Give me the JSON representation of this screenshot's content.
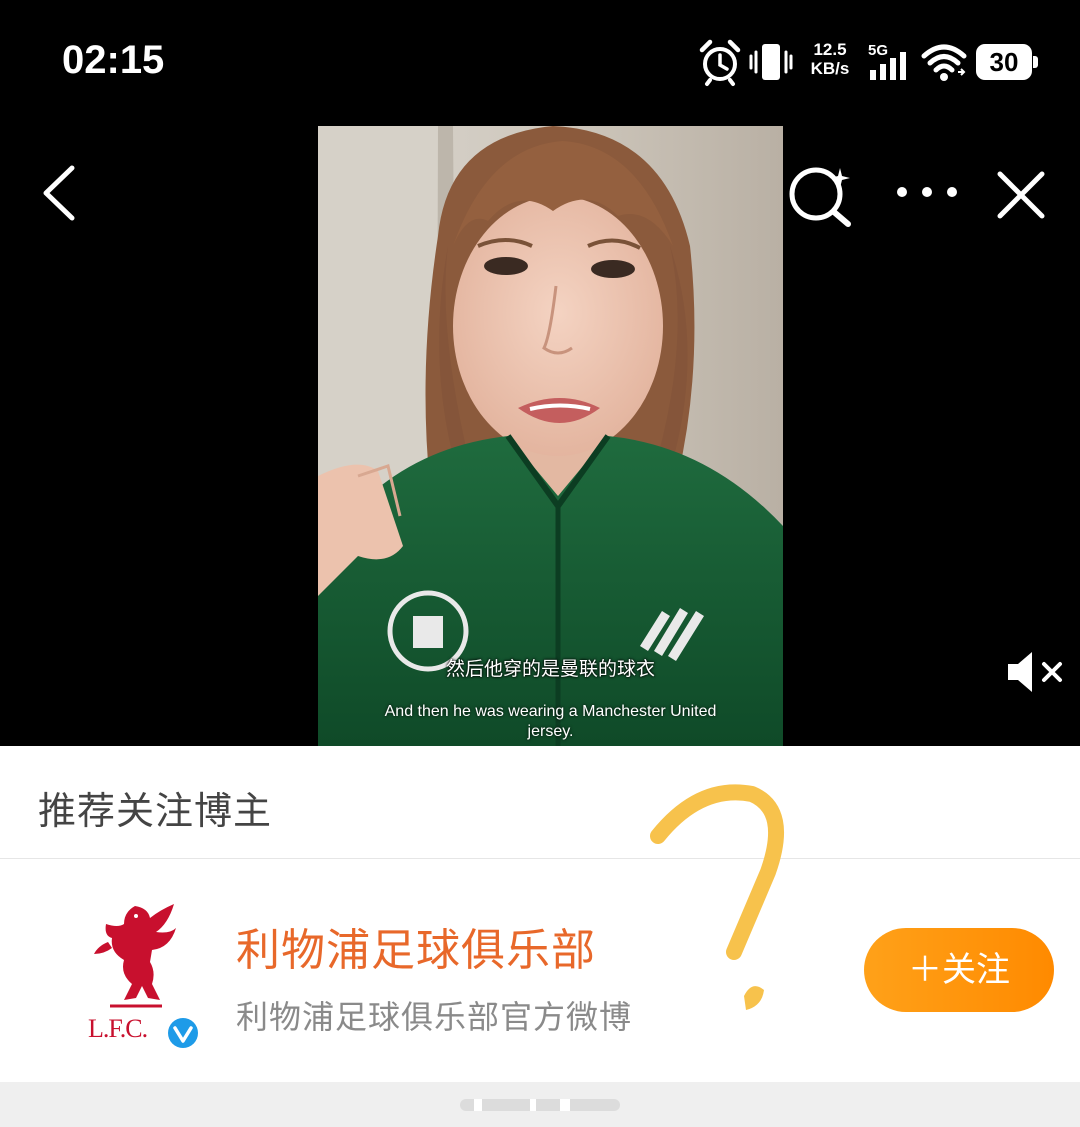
{
  "status_bar": {
    "time": "02:15",
    "net_speed_value": "12.5",
    "net_speed_unit": "KB/s",
    "network": "5G",
    "battery": "30",
    "icons": [
      "alarm-icon",
      "vibrate-icon",
      "signal-icon",
      "wifi-icon",
      "battery-icon"
    ]
  },
  "video": {
    "subtitle_zh": "然后他穿的是曼联的球衣",
    "subtitle_en": "And then he was wearing a Manchester United jersey.",
    "controls": [
      "back-icon",
      "smart-search-icon",
      "more-icon",
      "close-icon",
      "mute-icon"
    ]
  },
  "recommend": {
    "title": "推荐关注博主",
    "user": {
      "name": "利物浦足球俱乐部",
      "description": "利物浦足球俱乐部官方微博",
      "avatar_logo_text": "L.F.C.",
      "verified": true
    },
    "follow_label": "＋关注"
  },
  "colors": {
    "accent_orange": "#ff9a0e",
    "name_orange": "#e8682a",
    "verified_blue": "#1e9be8",
    "lfc_red": "#c8102e",
    "annotation_yellow": "#f7c24c"
  }
}
